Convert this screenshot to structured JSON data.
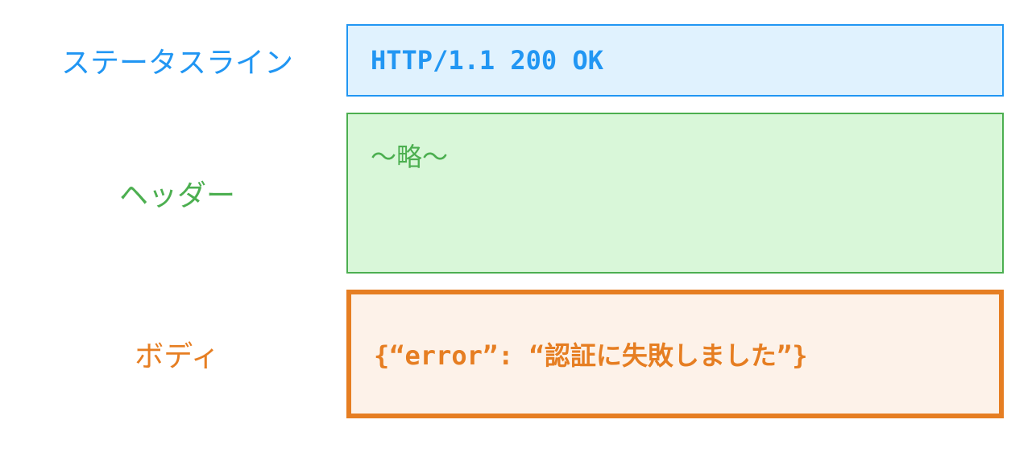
{
  "status": {
    "label": "ステータスライン",
    "content": "HTTP/1.1 200 OK"
  },
  "header": {
    "label": "ヘッダー",
    "content": "〜略〜"
  },
  "body": {
    "label": "ボディ",
    "content": "{“error”: “認証に失敗しました”}"
  }
}
